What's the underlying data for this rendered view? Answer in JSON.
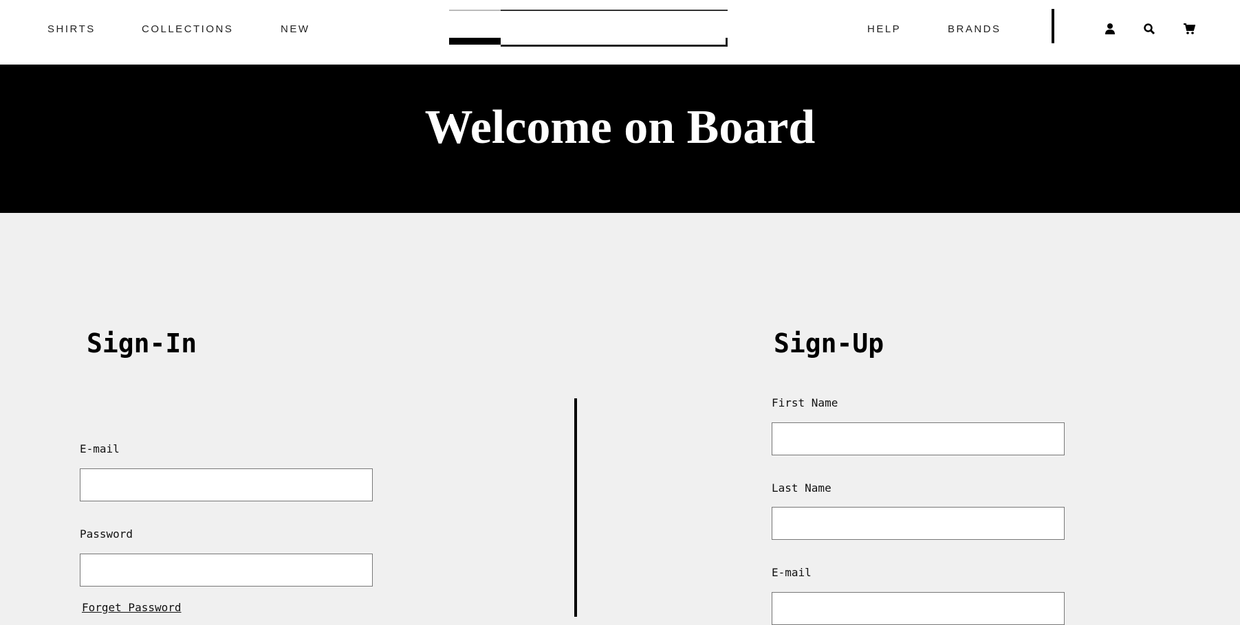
{
  "nav": {
    "left": [
      "SHIRTS",
      "COLLECTIONS",
      "NEW"
    ],
    "right": [
      "HELP",
      "BRANDS"
    ]
  },
  "icons": [
    "user-icon",
    "search-icon",
    "cart-icon"
  ],
  "banner": {
    "title": "Welcome on Board"
  },
  "signin": {
    "heading": "Sign-In",
    "email_label": "E-mail",
    "email_value": "",
    "password_label": "Password",
    "password_value": "",
    "forgot": "Forget Password"
  },
  "signup": {
    "heading": "Sign-Up",
    "first_label": "First Name",
    "last_label": "Last Name",
    "email_label": "E-mail"
  }
}
